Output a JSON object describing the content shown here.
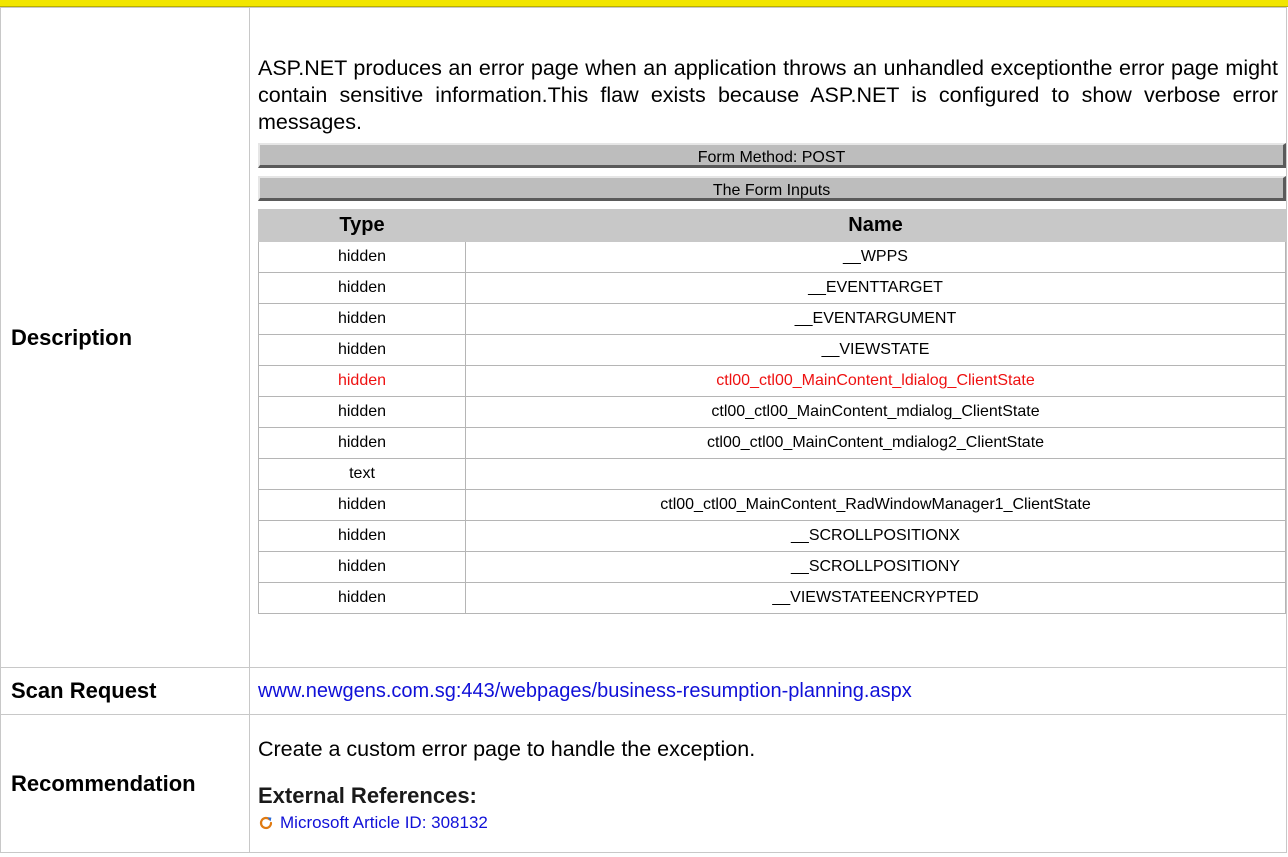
{
  "description": {
    "label": "Description",
    "text": "ASP.NET produces an error page when an application throws an unhandled exceptionthe error page might contain sensitive information.This flaw exists because ASP.NET is configured to show verbose error messages.",
    "form_method": "Form Method: POST",
    "form_inputs_title": "The Form Inputs",
    "table": {
      "headers": [
        "Type",
        "Name"
      ],
      "rows": [
        {
          "type": "hidden",
          "name": "__WPPS",
          "flagged": false
        },
        {
          "type": "hidden",
          "name": "__EVENTTARGET",
          "flagged": false
        },
        {
          "type": "hidden",
          "name": "__EVENTARGUMENT",
          "flagged": false
        },
        {
          "type": "hidden",
          "name": "__VIEWSTATE",
          "flagged": false
        },
        {
          "type": "hidden",
          "name": "ctl00_ctl00_MainContent_ldialog_ClientState",
          "flagged": true
        },
        {
          "type": "hidden",
          "name": "ctl00_ctl00_MainContent_mdialog_ClientState",
          "flagged": false
        },
        {
          "type": "hidden",
          "name": "ctl00_ctl00_MainContent_mdialog2_ClientState",
          "flagged": false
        },
        {
          "type": "text",
          "name": "",
          "flagged": false
        },
        {
          "type": "hidden",
          "name": "ctl00_ctl00_MainContent_RadWindowManager1_ClientState",
          "flagged": false
        },
        {
          "type": "hidden",
          "name": "__SCROLLPOSITIONX",
          "flagged": false
        },
        {
          "type": "hidden",
          "name": "__SCROLLPOSITIONY",
          "flagged": false
        },
        {
          "type": "hidden",
          "name": "__VIEWSTATEENCRYPTED",
          "flagged": false
        }
      ]
    }
  },
  "scan_request": {
    "label": "Scan Request",
    "url": "www.newgens.com.sg:443/webpages/business-resumption-planning.aspx"
  },
  "recommendation": {
    "label": "Recommendation",
    "text": "Create a custom error page to handle the exception.",
    "external_refs_title": "External References:",
    "refs": [
      {
        "label": "Microsoft Article ID: 308132",
        "icon": "refresh-link-icon"
      }
    ]
  },
  "colors": {
    "top_bar": "#f2e600",
    "link": "#1010d8",
    "flag": "#ee1111",
    "header_grey": "#c8c8c8"
  }
}
